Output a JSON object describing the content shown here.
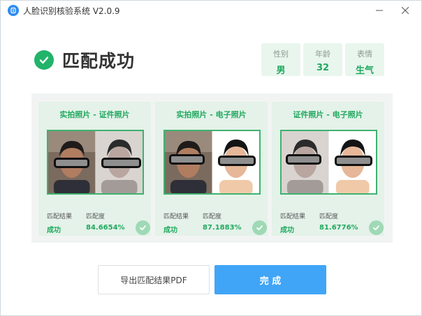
{
  "window": {
    "title": "人脸识别核验系统 V2.0.9",
    "controls": {
      "minimize_icon": "minimize-icon",
      "close_icon": "close-icon"
    }
  },
  "result": {
    "title": "匹配成功",
    "icon": "check-circle-icon",
    "color": "#21b46a"
  },
  "attributes": [
    {
      "label": "性别",
      "value": "男"
    },
    {
      "label": "年龄",
      "value": "32"
    },
    {
      "label": "表情",
      "value": "生气"
    }
  ],
  "matches": [
    {
      "title": "实拍照片 - 证件照片",
      "photos": [
        "live-photo",
        "id-photo"
      ],
      "result_label": "匹配结果",
      "similarity_label": "匹配度",
      "result": "成功",
      "similarity": "84.6654%"
    },
    {
      "title": "实拍照片 - 电子照片",
      "photos": [
        "live-photo",
        "electronic-photo"
      ],
      "result_label": "匹配结果",
      "similarity_label": "匹配度",
      "result": "成功",
      "similarity": "87.1883%"
    },
    {
      "title": "证件照片 - 电子照片",
      "photos": [
        "id-photo",
        "electronic-photo"
      ],
      "result_label": "匹配结果",
      "similarity_label": "匹配度",
      "result": "成功",
      "similarity": "81.6776%"
    }
  ],
  "footer": {
    "export_label": "导出匹配结果PDF",
    "done_label": "完 成"
  },
  "colors": {
    "accent_green": "#21a95f",
    "primary_blue": "#41a5f7",
    "card_bg": "#e4f2e9"
  }
}
